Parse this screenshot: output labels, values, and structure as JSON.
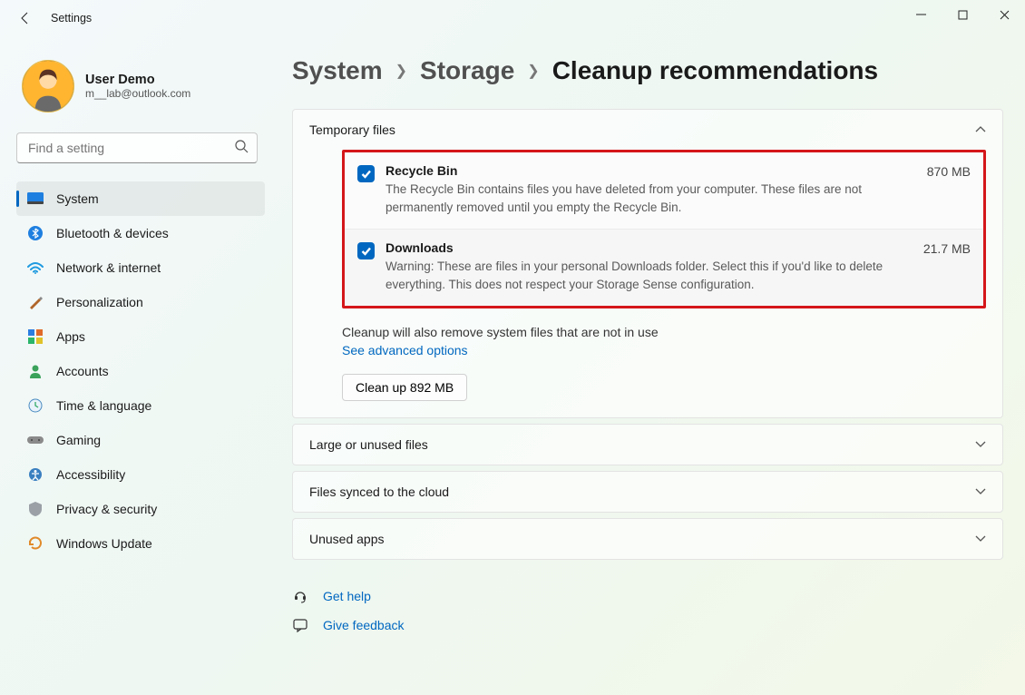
{
  "window": {
    "app_title": "Settings"
  },
  "user": {
    "name": "User Demo",
    "email": "m__lab@outlook.com"
  },
  "search": {
    "placeholder": "Find a setting"
  },
  "sidebar": {
    "items": [
      {
        "label": "System"
      },
      {
        "label": "Bluetooth & devices"
      },
      {
        "label": "Network & internet"
      },
      {
        "label": "Personalization"
      },
      {
        "label": "Apps"
      },
      {
        "label": "Accounts"
      },
      {
        "label": "Time & language"
      },
      {
        "label": "Gaming"
      },
      {
        "label": "Accessibility"
      },
      {
        "label": "Privacy & security"
      },
      {
        "label": "Windows Update"
      }
    ]
  },
  "breadcrumb": {
    "a": "System",
    "b": "Storage",
    "c": "Cleanup recommendations"
  },
  "sections": {
    "temp_files": {
      "header": "Temporary files",
      "items": [
        {
          "title": "Recycle Bin",
          "desc": "The Recycle Bin contains files you have deleted from your computer. These files are not permanently removed until you empty the Recycle Bin.",
          "size": "870 MB"
        },
        {
          "title": "Downloads",
          "desc": "Warning: These are files in your personal Downloads folder. Select this if you'd like to delete everything. This does not respect your Storage Sense configuration.",
          "size": "21.7 MB"
        }
      ],
      "note": "Cleanup will also remove system files that are not in use",
      "advanced_link": "See advanced options",
      "cleanup_button": "Clean up 892 MB"
    },
    "large_unused": {
      "header": "Large or unused files"
    },
    "cloud": {
      "header": "Files synced to the cloud"
    },
    "unused_apps": {
      "header": "Unused apps"
    }
  },
  "help": {
    "get_help": "Get help",
    "give_feedback": "Give feedback"
  }
}
